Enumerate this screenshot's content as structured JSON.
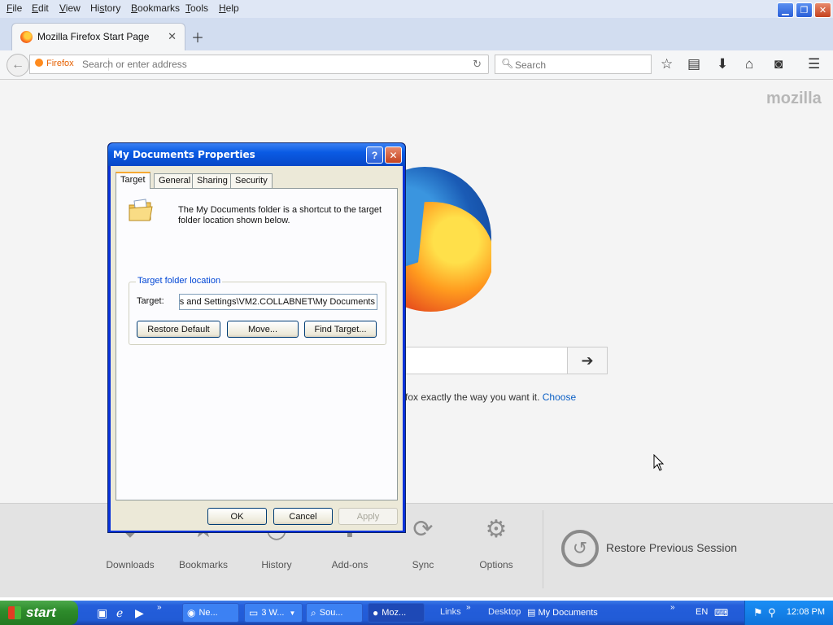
{
  "menubar": {
    "items": [
      {
        "pre": "",
        "key": "F",
        "post": "ile"
      },
      {
        "pre": "",
        "key": "E",
        "post": "dit"
      },
      {
        "pre": "",
        "key": "V",
        "post": "iew"
      },
      {
        "pre": "Hi",
        "key": "s",
        "post": "tory"
      },
      {
        "pre": "",
        "key": "B",
        "post": "ookmarks"
      },
      {
        "pre": "",
        "key": "T",
        "post": "ools"
      },
      {
        "pre": "",
        "key": "H",
        "post": "elp"
      }
    ]
  },
  "tab": {
    "title": "Mozilla Firefox Start Page"
  },
  "navbar": {
    "identity": "Firefox",
    "url_placeholder": "Search or enter address",
    "search_placeholder": "Search"
  },
  "content": {
    "brand": "mozilla",
    "tagline_visible": "fox exactly the way you want it.",
    "tagline_link": "Choose",
    "launchers": [
      {
        "label": "Downloads",
        "icon": "download-icon"
      },
      {
        "label": "Bookmarks",
        "icon": "star-icon"
      },
      {
        "label": "History",
        "icon": "clock-icon"
      },
      {
        "label": "Add-ons",
        "icon": "puzzle-icon"
      },
      {
        "label": "Sync",
        "icon": "sync-icon"
      },
      {
        "label": "Options",
        "icon": "gear-icon"
      }
    ],
    "restore_label": "Restore Previous Session"
  },
  "dialog": {
    "title": "My Documents Properties",
    "tabs": [
      "Target",
      "General",
      "Sharing",
      "Security"
    ],
    "active_tab": "Target",
    "description": "The My Documents folder is a shortcut to the target folder location shown below.",
    "group_label": "Target folder location",
    "target_label": "Target:",
    "target_value": ":s and Settings\\VM2.COLLABNET\\My Documents",
    "buttons": {
      "restore_default": "Restore Default",
      "move": "Move...",
      "find_target": "Find Target...",
      "ok": "OK",
      "cancel": "Cancel",
      "apply": "Apply"
    }
  },
  "taskbar": {
    "start": "start",
    "tasks": [
      {
        "label": "Ne...",
        "icon": "chrome-icon"
      },
      {
        "label": "3 W...",
        "icon": "folder-icon"
      },
      {
        "label": "Sou...",
        "icon": "search-tool-icon"
      },
      {
        "label": "Moz...",
        "icon": "firefox-icon"
      }
    ],
    "links": "Links",
    "desktop": "Desktop",
    "mydocs": "My Documents",
    "lang": "EN",
    "clock": "12:08 PM"
  },
  "colors": {
    "xp_blue": "#245edb",
    "xp_green": "#2e8c2c",
    "firefox_orange": "#e66000",
    "link_blue": "#0b5fc5"
  }
}
